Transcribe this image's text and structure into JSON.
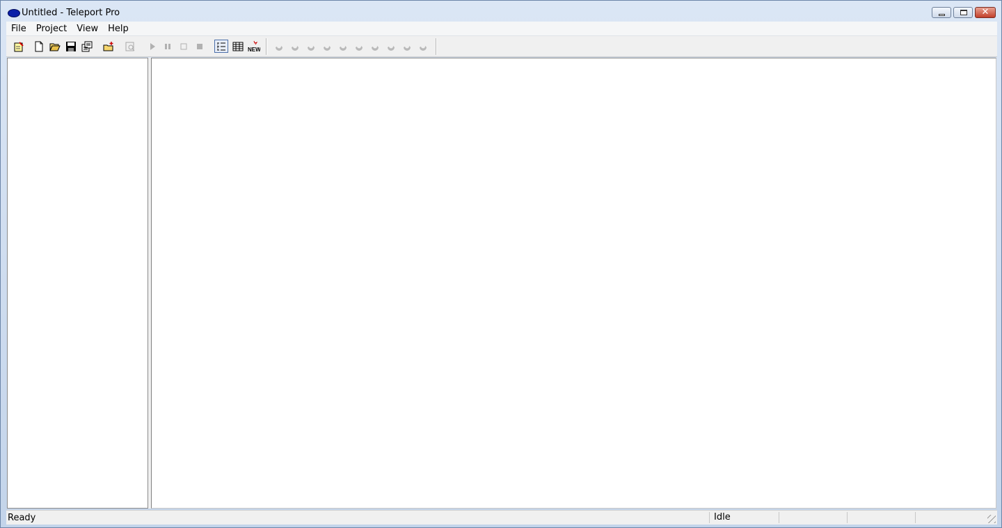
{
  "window": {
    "title": "Untitled - Teleport Pro",
    "close_glyph": "✕"
  },
  "menu": [
    "File",
    "Project",
    "View",
    "Help"
  ],
  "toolbar": {
    "buttons": [
      {
        "id": "new-project-wizard",
        "icon": "wizard-icon"
      },
      {
        "id": "new",
        "icon": "new-document-icon"
      },
      {
        "id": "open",
        "icon": "folder-open-icon"
      },
      {
        "id": "save",
        "icon": "floppy-disk-icon"
      },
      {
        "id": "properties",
        "icon": "properties-icon"
      },
      {
        "id": "new-address",
        "icon": "add-folder-icon"
      },
      {
        "id": "browse",
        "icon": "browse-icon"
      },
      {
        "id": "start",
        "icon": "play-icon"
      },
      {
        "id": "pause",
        "icon": "pause-icon"
      },
      {
        "id": "stop",
        "icon": "stop-outline-icon"
      },
      {
        "id": "cancel",
        "icon": "stop-icon"
      },
      {
        "id": "tree-view",
        "icon": "tree-view-icon"
      },
      {
        "id": "list-view",
        "icon": "list-view-icon"
      },
      {
        "id": "new-files",
        "icon": "new-files-icon",
        "label": "NEW"
      }
    ],
    "thread_count": 10
  },
  "status": {
    "left": "Ready",
    "state": "Idle",
    "cells": [
      "",
      "",
      ""
    ]
  },
  "colors": {
    "title_icon": "#0a1fa8",
    "window_frame": "#c9d9ee"
  }
}
